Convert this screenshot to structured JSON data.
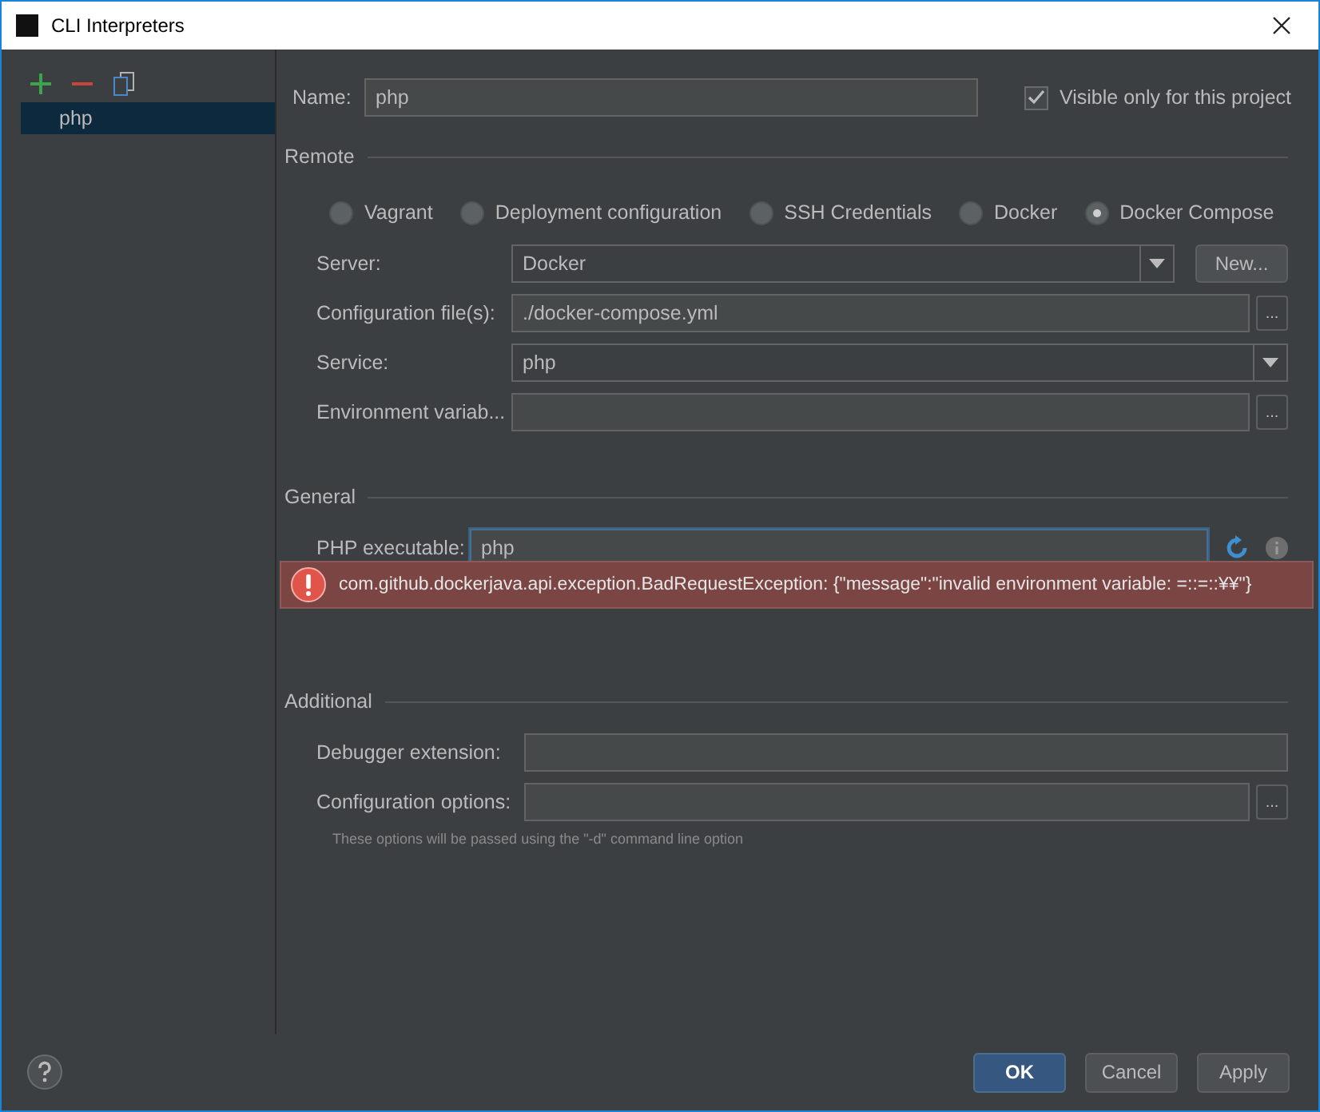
{
  "window": {
    "title": "CLI Interpreters"
  },
  "sidebar": {
    "items": [
      {
        "label": "php",
        "selected": true
      }
    ]
  },
  "name_field": {
    "label": "Name:",
    "value": "php"
  },
  "visible_only": {
    "label": "Visible only for this project",
    "checked": true
  },
  "remote": {
    "title": "Remote",
    "options": [
      {
        "label": "Vagrant",
        "selected": false
      },
      {
        "label": "Deployment configuration",
        "selected": false
      },
      {
        "label": "SSH Credentials",
        "selected": false
      },
      {
        "label": "Docker",
        "selected": false
      },
      {
        "label": "Docker Compose",
        "selected": true
      }
    ],
    "fields": [
      {
        "kind": "combo",
        "label": "Server:",
        "value": "Docker",
        "button": "New..."
      },
      {
        "kind": "browse",
        "label": "Configuration file(s):",
        "value": "./docker-compose.yml",
        "button": "..."
      },
      {
        "kind": "combo",
        "label": "Service:",
        "value": "php"
      },
      {
        "kind": "browse",
        "label": "Environment variab...",
        "button": "..."
      }
    ]
  },
  "general": {
    "title": "General",
    "php_executable": {
      "label": "PHP executable:",
      "value": "php"
    },
    "error": "com.github.dockerjava.api.exception.BadRequestException: {\"message\":\"invalid environment variable: =::=::¥¥\"}"
  },
  "additional": {
    "title": "Additional",
    "fields": [
      {
        "kind": "text",
        "label": "Debugger extension:"
      },
      {
        "kind": "browse",
        "label": "Configuration options:",
        "button": "..."
      }
    ],
    "hint": "These options will be passed using the \"-d\" command line option"
  },
  "buttons": [
    {
      "label": "OK",
      "kind": "default"
    },
    {
      "label": "Cancel",
      "kind": "normal"
    },
    {
      "label": "Apply",
      "kind": "normal"
    }
  ]
}
